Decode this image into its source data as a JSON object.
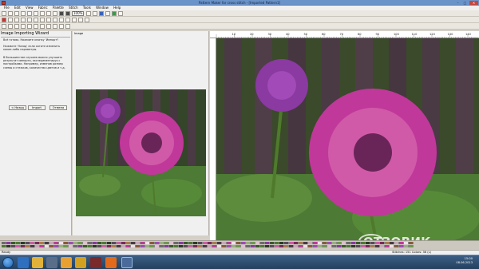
{
  "window": {
    "title": "Pattern Maker for cross stitch - [Imported Pattern1]",
    "minimize": "–",
    "maximize": "□",
    "close": "✕"
  },
  "menu": [
    "File",
    "Edit",
    "View",
    "Fabric",
    "Palette",
    "Stitch",
    "Tools",
    "Window",
    "Help"
  ],
  "toolbar": {
    "zoom_value": "100%"
  },
  "wizard": {
    "title": "Image Importing Wizard",
    "text1": "Всё готово. Нажмите кнопку 'Импорт'!",
    "text2": "Нажмите 'Назад' если хотите изменить какие-либо параметры.",
    "text3": "В большинстве случаев можно улучшить результат импорта, экспериментируя с настройками. Например, изменив размер схемы и стежков, количество цветов и т.д.",
    "back_button": "< Назад",
    "import_button": "Import",
    "cancel_button": "Отмена"
  },
  "preview": {
    "label": "Image"
  },
  "ruler": {
    "marks": [
      "10",
      "20",
      "30",
      "40",
      "50",
      "60",
      "70",
      "80",
      "90",
      "100",
      "110",
      "120",
      "130",
      "140"
    ]
  },
  "status": {
    "left": "Ready",
    "right": "Stitches: 151 Colors: 36 (L)"
  },
  "clock": {
    "time": "15:00",
    "date": "08.06.2013"
  },
  "watermark": "ОТЗОВИК",
  "colors": {
    "titlebar": "#6a93c9",
    "panel": "#f0f0f0",
    "taskbar": "#2b4a6e",
    "dahlia": "#c0389a",
    "fence": "#4a3a44",
    "leaf": "#4d7a34"
  }
}
